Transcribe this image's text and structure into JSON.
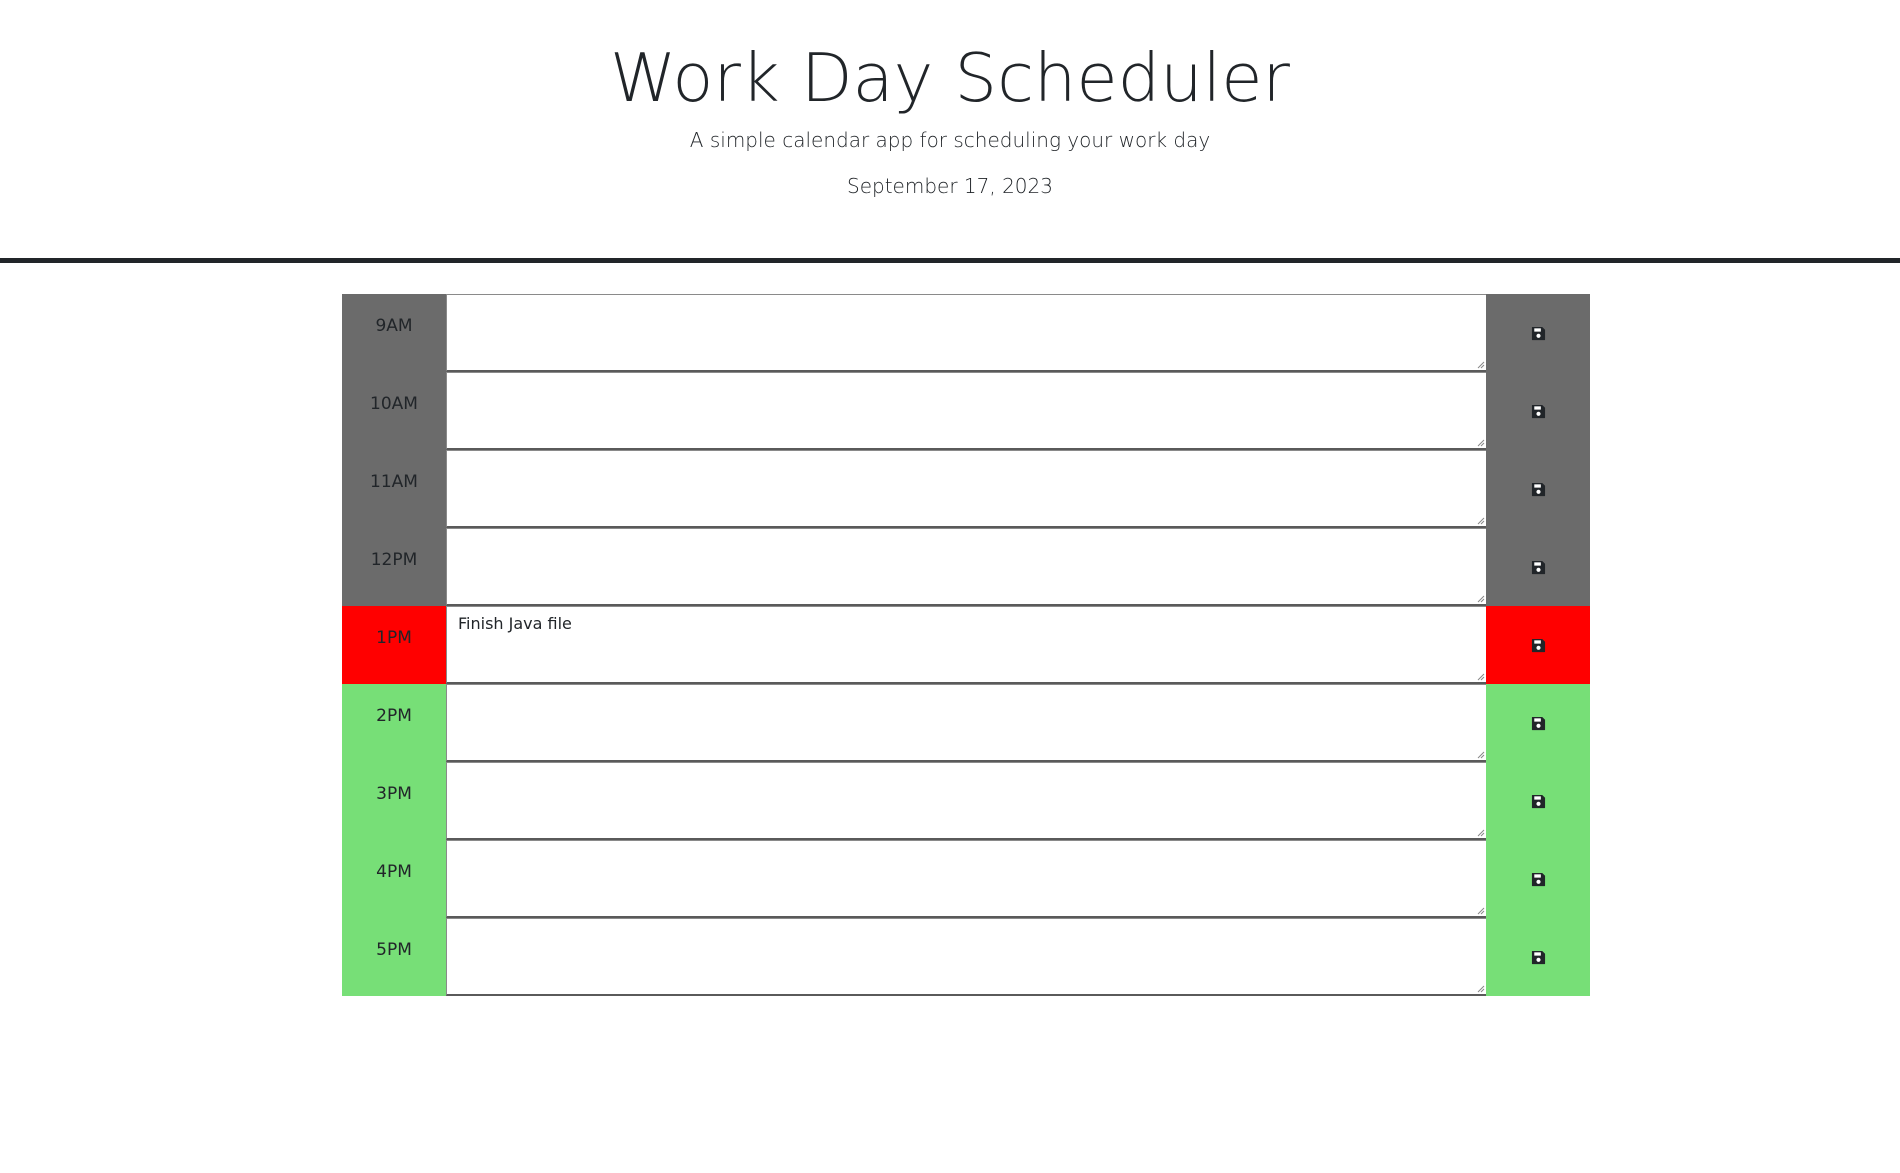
{
  "header": {
    "title": "Work Day Scheduler",
    "subtitle": "A simple calendar app for scheduling your work day",
    "date": "September 17, 2023"
  },
  "colors": {
    "past": "#6b6b6b",
    "present": "#ff0000",
    "future": "#77df77",
    "divider": "#212529"
  },
  "icons": {
    "save": "floppy-disk-icon"
  },
  "rows": [
    {
      "hour": "9AM",
      "text": "",
      "state": "past"
    },
    {
      "hour": "10AM",
      "text": "",
      "state": "past"
    },
    {
      "hour": "11AM",
      "text": "",
      "state": "past"
    },
    {
      "hour": "12PM",
      "text": "",
      "state": "past"
    },
    {
      "hour": "1PM",
      "text": "Finish Java file",
      "state": "present"
    },
    {
      "hour": "2PM",
      "text": "",
      "state": "future"
    },
    {
      "hour": "3PM",
      "text": "",
      "state": "future"
    },
    {
      "hour": "4PM",
      "text": "",
      "state": "future"
    },
    {
      "hour": "5PM",
      "text": "",
      "state": "future"
    }
  ]
}
